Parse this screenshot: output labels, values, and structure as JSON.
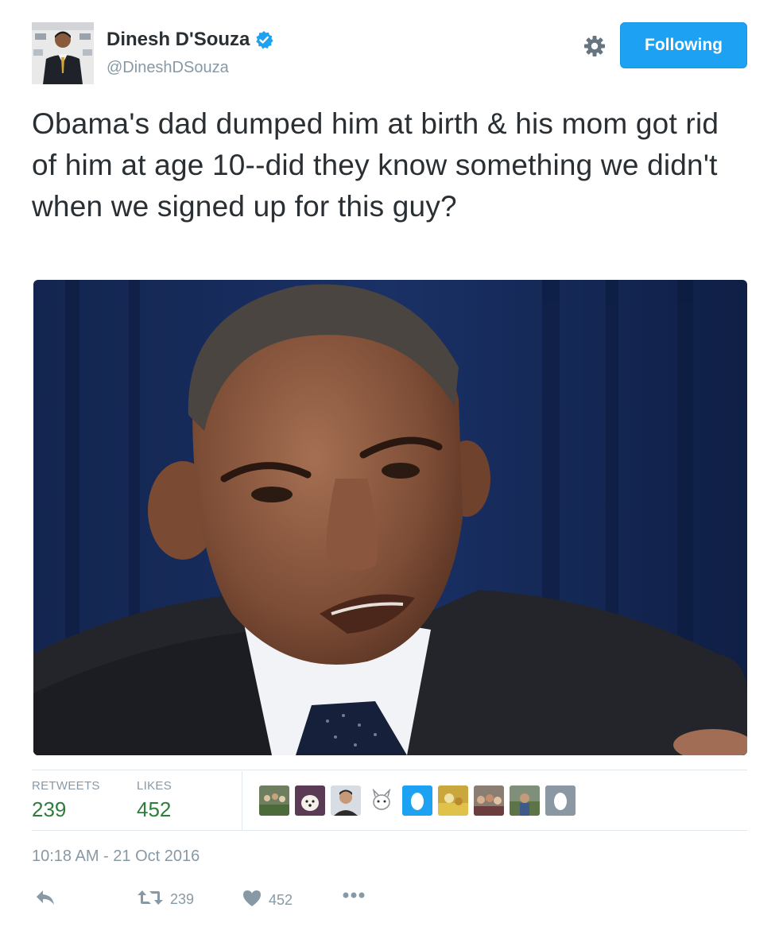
{
  "author": {
    "display_name": "Dinesh D'Souza",
    "handle": "@DineshDSouza",
    "verified": true
  },
  "follow_button": {
    "label": "Following"
  },
  "tweet": {
    "text": "Obama's dad dumped him at birth & his mom got rid of him at age 10--did they know something we didn't when we signed up for this guy?",
    "timestamp": "10:18 AM - 21 Oct 2016"
  },
  "stats": {
    "retweets_label": "RETWEETS",
    "retweets": "239",
    "likes_label": "LIKES",
    "likes": "452"
  },
  "likers": [
    {
      "icon": "group-photo-icon"
    },
    {
      "icon": "dog-photo-icon"
    },
    {
      "icon": "person-photo-icon"
    },
    {
      "icon": "cartoon-photo-icon"
    },
    {
      "icon": "default-egg-icon"
    },
    {
      "icon": "yellow-photo-icon"
    },
    {
      "icon": "crowd-photo-icon"
    },
    {
      "icon": "outdoor-photo-icon"
    },
    {
      "icon": "default-egg-icon"
    }
  ],
  "actions": {
    "reply_icon": "reply-icon",
    "retweet_count": "239",
    "like_count": "452",
    "more_icon": "more-icon"
  },
  "colors": {
    "accent": "#1da1f2",
    "stat_value": "#2f7d3c",
    "muted": "#8899a6",
    "text": "#292f33"
  }
}
